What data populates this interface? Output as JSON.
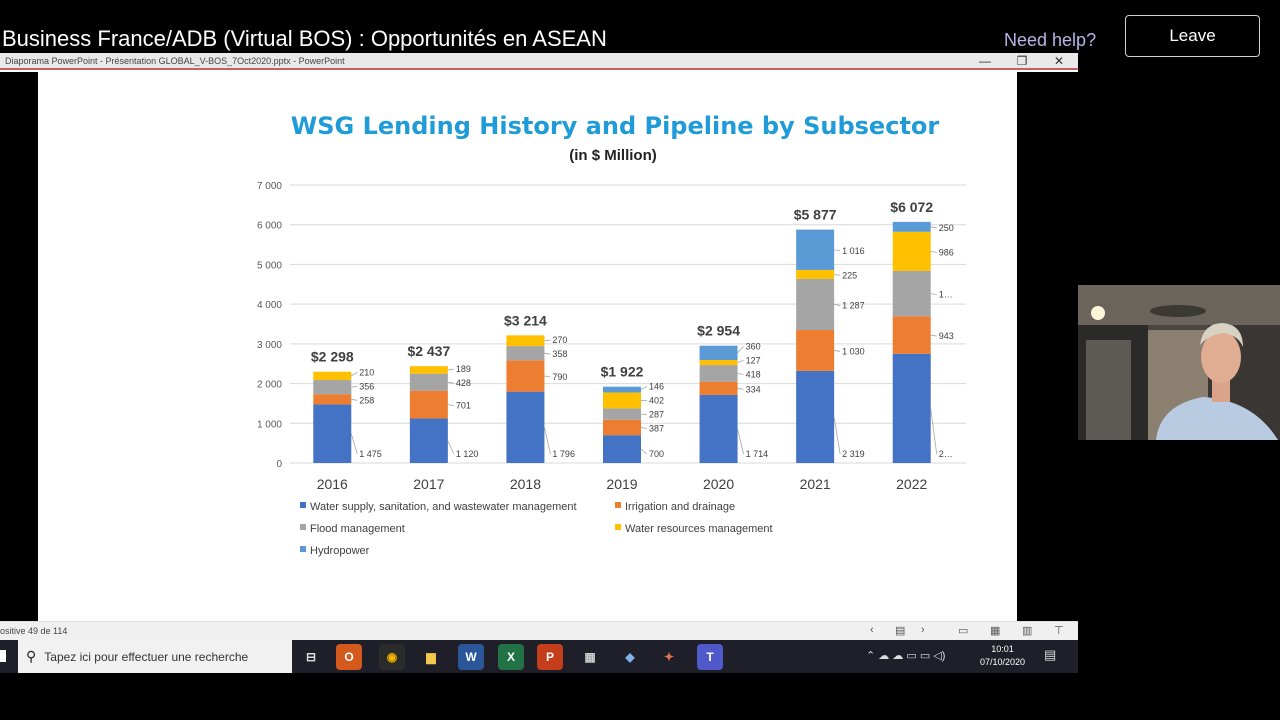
{
  "meeting": {
    "title": "Business France/ADB (Virtual BOS) : Opportunités en ASEAN",
    "help_link": "Need help?",
    "leave_label": "Leave"
  },
  "ppt": {
    "window_title": "Diaporama PowerPoint  -  Présentation GLOBAL_V-BOS_7Oct2020.pptx - PowerPoint",
    "minimize": "—",
    "maximize": "❐",
    "close": "✕",
    "status": "ositive 49 de 114"
  },
  "slide": {
    "title": "WSG Lending History and Pipeline by Subsector",
    "subtitle": "(in $ Million)"
  },
  "chart_data": {
    "type": "bar",
    "stacked": true,
    "categories": [
      "2016",
      "2017",
      "2018",
      "2019",
      "2020",
      "2021",
      "2022"
    ],
    "ylim": [
      0,
      7000
    ],
    "yticks": [
      "0",
      "1 000",
      "2 000",
      "3 000",
      "4 000",
      "5 000",
      "6 000",
      "7 000"
    ],
    "grid": true,
    "legend_position": "bottom",
    "totals": [
      "$2 298",
      "$2 437",
      "$3 214",
      "$1 922",
      "$2 954",
      "$5 877",
      "$6 072"
    ],
    "series": [
      {
        "name": "Water supply, sanitation, and wastewater management",
        "color": "#4472c4",
        "values": [
          1475,
          1120,
          1796,
          700,
          1714,
          2319,
          2750
        ],
        "labels": [
          "1 475",
          "1 120",
          "1 796",
          "700",
          "1 714",
          "2 319",
          "2…"
        ]
      },
      {
        "name": "Irrigation and drainage",
        "color": "#ed7d31",
        "values": [
          258,
          701,
          790,
          387,
          334,
          1030,
          943
        ],
        "labels": [
          "258",
          "701",
          "790",
          "387",
          "334",
          "1 030",
          "943"
        ]
      },
      {
        "name": "Flood management",
        "color": "#a5a5a5",
        "values": [
          356,
          428,
          358,
          287,
          418,
          1287,
          1143
        ],
        "labels": [
          "356",
          "428",
          "358",
          "287",
          "418",
          "1 287",
          "1…"
        ]
      },
      {
        "name": "Water resources management",
        "color": "#ffc000",
        "values": [
          210,
          189,
          270,
          402,
          127,
          225,
          986
        ],
        "labels": [
          "210",
          "189",
          "270",
          "402",
          "127",
          "225",
          "986"
        ]
      },
      {
        "name": "Hydropower",
        "color": "#5b9bd5",
        "values": [
          0,
          0,
          0,
          146,
          360,
          1016,
          250
        ],
        "labels": [
          "",
          "",
          "",
          "146",
          "360",
          "1 016",
          "250"
        ]
      }
    ]
  },
  "taskbar": {
    "search_placeholder": "Tapez ici pour effectuer une recherche",
    "time": "10:01",
    "date": "07/10/2020"
  }
}
